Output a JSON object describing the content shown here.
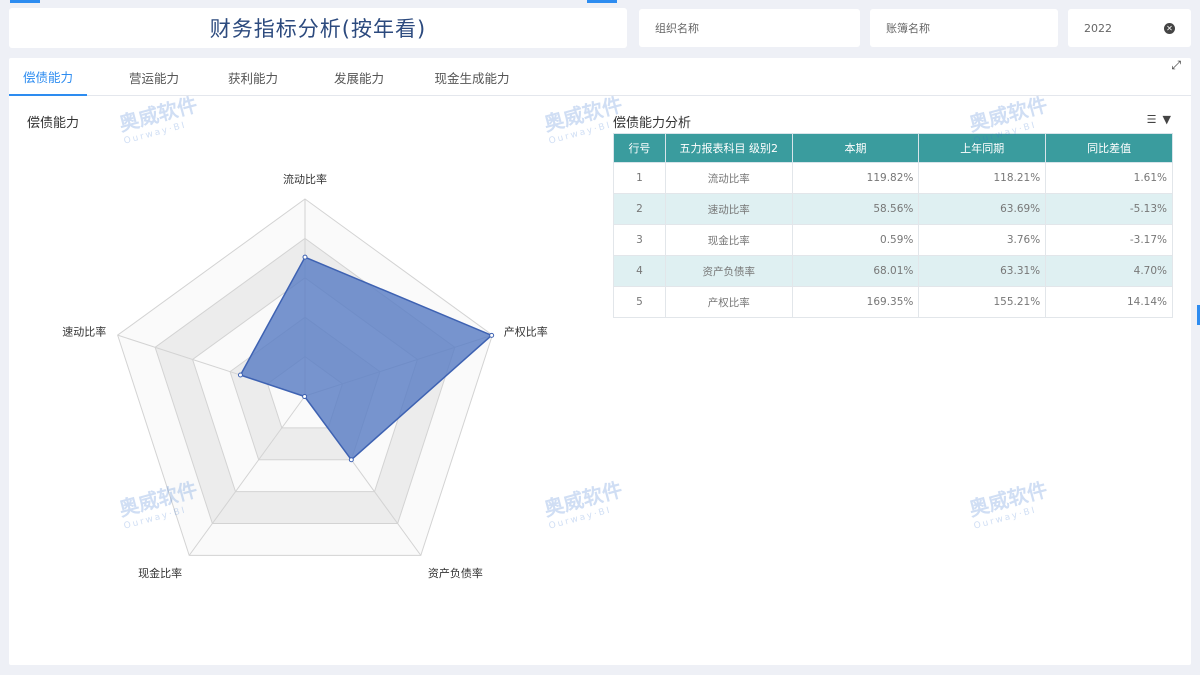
{
  "header": {
    "title": "财务指标分析(按年看)"
  },
  "filters": {
    "org_placeholder": "组织名称",
    "ledger_placeholder": "账簿名称",
    "year_value": "2022"
  },
  "tabs": [
    {
      "label": "偿债能力",
      "active": true
    },
    {
      "label": "营运能力",
      "active": false
    },
    {
      "label": "获利能力",
      "active": false
    },
    {
      "label": "发展能力",
      "active": false
    },
    {
      "label": "现金生成能力",
      "active": false
    }
  ],
  "left_panel": {
    "title": "偿债能力"
  },
  "right_panel": {
    "title": "偿债能力分析"
  },
  "watermark": {
    "text": "奥威软件",
    "sub": "Ourway·BI"
  },
  "chart_data": {
    "type": "radar",
    "indicators": [
      "流动比率",
      "产权比率",
      "资产负债率",
      "现金比率",
      "速动比率"
    ],
    "values": [
      119.82,
      169.35,
      68.01,
      0.59,
      58.56
    ],
    "max": 170,
    "fill_color": "#5a7ec4",
    "line_color": "#3e62b2"
  },
  "table": {
    "headers": [
      "行号",
      "五力报表科目 级别2",
      "本期",
      "上年同期",
      "同比差值"
    ],
    "rows": [
      {
        "no": "1",
        "name": "流动比率",
        "current": "119.82%",
        "prior": "118.21%",
        "diff": "1.61%",
        "neg": false
      },
      {
        "no": "2",
        "name": "速动比率",
        "current": "58.56%",
        "prior": "63.69%",
        "diff": "-5.13%",
        "neg": true
      },
      {
        "no": "3",
        "name": "现金比率",
        "current": "0.59%",
        "prior": "3.76%",
        "diff": "-3.17%",
        "neg": true
      },
      {
        "no": "4",
        "name": "资产负债率",
        "current": "68.01%",
        "prior": "63.31%",
        "diff": "4.70%",
        "neg": false
      },
      {
        "no": "5",
        "name": "产权比率",
        "current": "169.35%",
        "prior": "155.21%",
        "diff": "14.14%",
        "neg": false
      }
    ]
  }
}
